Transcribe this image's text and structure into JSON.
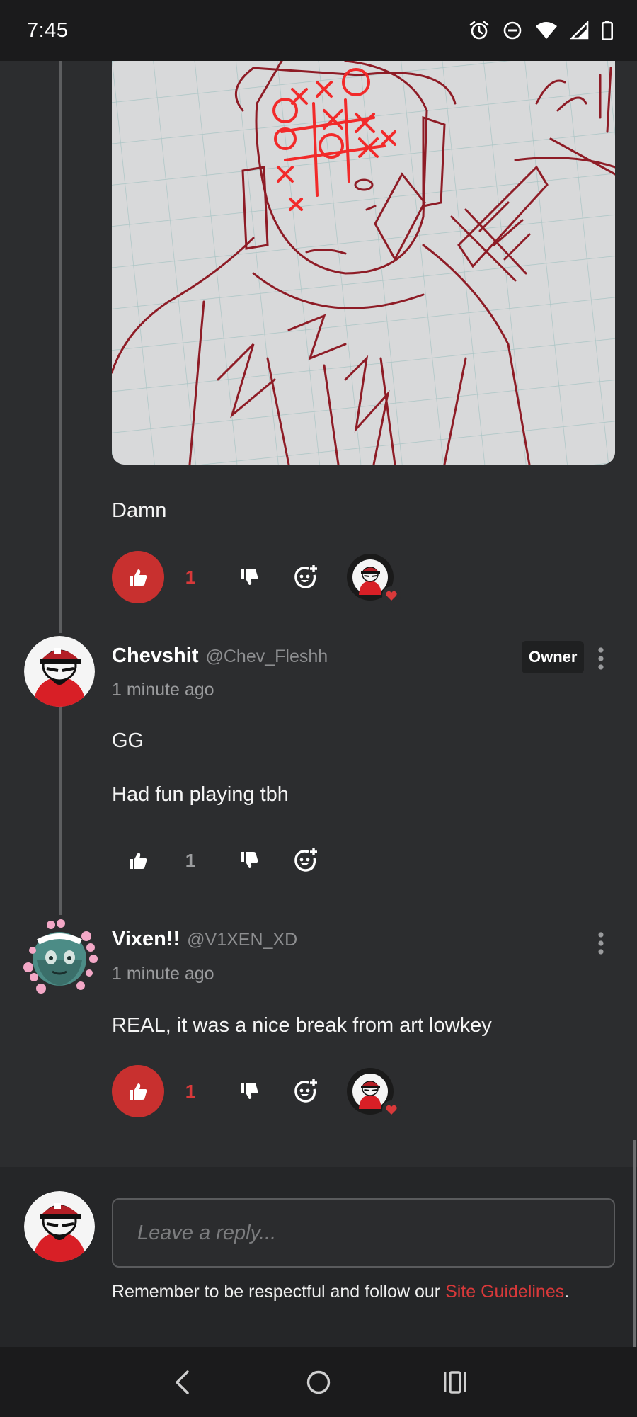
{
  "status_bar": {
    "time": "7:45"
  },
  "top_comment": {
    "text": "Damn",
    "likes": "1"
  },
  "comments": [
    {
      "author": "Chevshit",
      "handle": "@Chev_Fleshh",
      "time": "1 minute ago",
      "badge": "Owner",
      "lines": [
        "GG",
        "Had fun playing tbh"
      ],
      "likes": "1"
    },
    {
      "author": "Vixen!!",
      "handle": "@V1XEN_XD",
      "time": "1 minute ago",
      "lines": [
        "REAL, it was a nice break from art lowkey"
      ],
      "likes": "1"
    }
  ],
  "reply": {
    "placeholder": "Leave a reply...",
    "guidelines_prefix": "Remember to be respectful and follow our ",
    "guidelines_link": "Site Guidelines",
    "guidelines_suffix": "."
  },
  "colors": {
    "accent": "#c8302f",
    "background": "#2c2d2f"
  },
  "icons": [
    "thumbs-up-icon",
    "thumbs-down-icon",
    "add-reaction-icon",
    "more-vertical-icon",
    "heart-icon",
    "back-icon",
    "home-icon",
    "recents-icon"
  ]
}
